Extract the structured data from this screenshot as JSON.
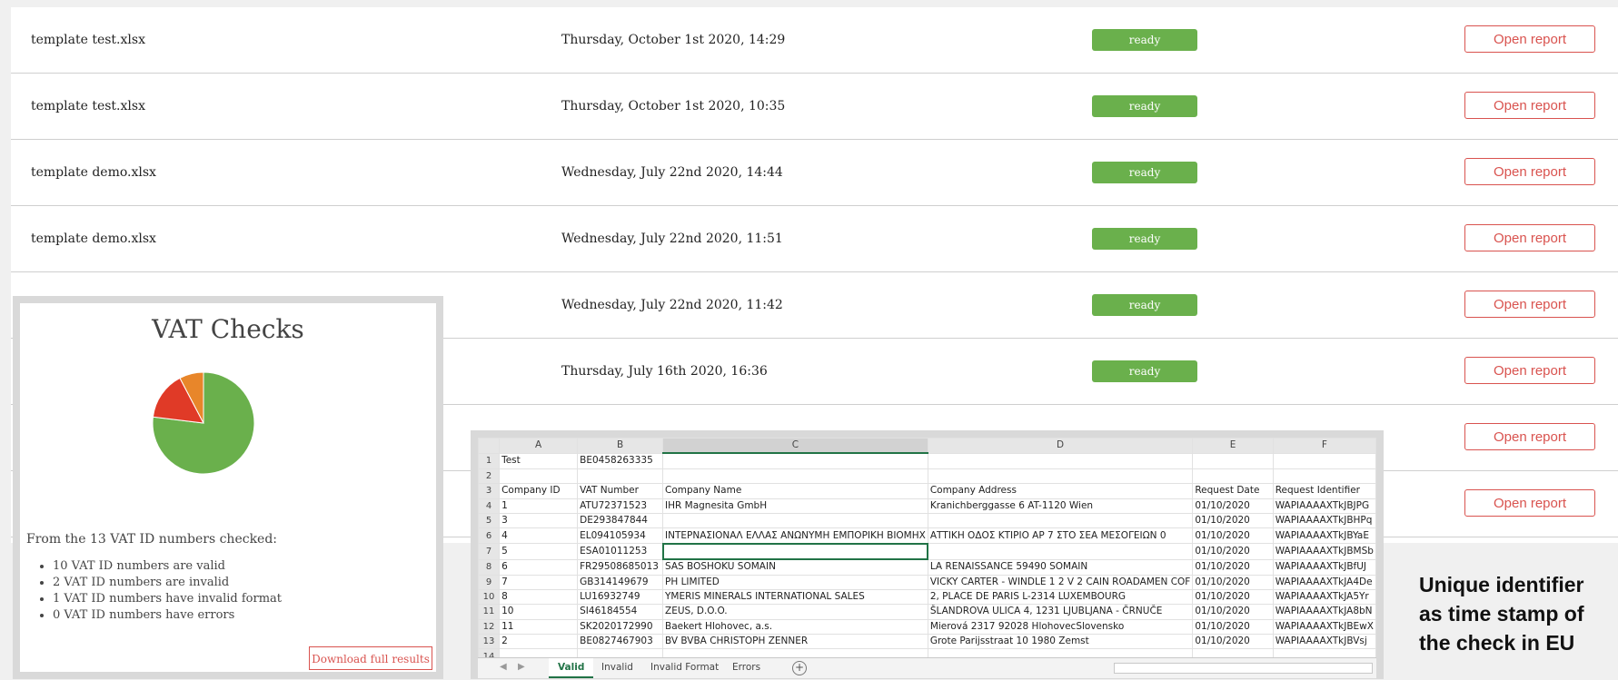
{
  "reports": [
    {
      "name": "template test.xlsx",
      "date": "Thursday, October 1st 2020, 14:29",
      "status": "ready",
      "action": "Open report"
    },
    {
      "name": "template test.xlsx",
      "date": "Thursday, October 1st 2020, 10:35",
      "status": "ready",
      "action": "Open report"
    },
    {
      "name": "template demo.xlsx",
      "date": "Wednesday, July 22nd 2020, 14:44",
      "status": "ready",
      "action": "Open report"
    },
    {
      "name": "template demo.xlsx",
      "date": "Wednesday, July 22nd 2020, 11:51",
      "status": "ready",
      "action": "Open report"
    },
    {
      "name": "",
      "date": "Wednesday, July 22nd 2020, 11:42",
      "status": "ready",
      "action": "Open report"
    },
    {
      "name": "",
      "date": "Thursday, July 16th 2020, 16:36",
      "status": "ready",
      "action": "Open report"
    },
    {
      "name": "",
      "date": "",
      "status": "",
      "action": "Open report"
    },
    {
      "name": "",
      "date": "",
      "status": "",
      "action": "Open report"
    }
  ],
  "vat_panel": {
    "title": "VAT Checks",
    "summary": "From the 13 VAT ID numbers checked:",
    "items": [
      "10 VAT ID numbers are valid",
      "2 VAT ID numbers are invalid",
      "1 VAT ID numbers have invalid format",
      "0 VAT ID numbers have errors"
    ],
    "download": "Download full results"
  },
  "chart_data": {
    "type": "pie",
    "values": [
      10,
      2,
      1,
      0
    ],
    "colors": [
      "#6ab04c",
      "#e03a27",
      "#e8862a",
      "#999999"
    ]
  },
  "spreadsheet": {
    "columns": [
      "A",
      "B",
      "C",
      "D",
      "E",
      "F"
    ],
    "rows": [
      [
        "1",
        "Test",
        "BE0458263335",
        "",
        "",
        "",
        ""
      ],
      [
        "2",
        "",
        "",
        "",
        "",
        "",
        ""
      ],
      [
        "3",
        "Company ID",
        "VAT Number",
        "Company Name",
        "Company Address",
        "Request Date",
        "Request Identifier"
      ],
      [
        "4",
        "1",
        "ATU72371523",
        "IHR Magnesita GmbH",
        "Kranichberggasse 6 AT-1120 Wien",
        "01/10/2020",
        "WAPIAAAAXTkJBJPG"
      ],
      [
        "5",
        "3",
        "DE293847844",
        "",
        "",
        "01/10/2020",
        "WAPIAAAAXTkJBHPq"
      ],
      [
        "6",
        "4",
        "EL094105934",
        "ΙΝΤΕΡΝΑΣΙΟΝΑΛ ΕΛΛΑΣ ΑΝΩΝΥΜΗ ΕΜΠΟΡΙΚΗ ΒΙΟΜΗΧ",
        "ΑΤΤΙΚΗ ΟΔΟΣ ΚΤΙΡΙΟ ΑΡ 7 ΣΤΟ ΣΕΑ ΜΕΣΟΓΕΙΩΝ 0",
        "01/10/2020",
        "WAPIAAAAXTkJBYaE"
      ],
      [
        "7",
        "5",
        "ESA01011253",
        "",
        "",
        "01/10/2020",
        "WAPIAAAAXTkJBMSb"
      ],
      [
        "8",
        "6",
        "FR29508685013",
        "SAS BOSHOKU SOMAIN",
        "LA RENAISSANCE 59490 SOMAIN",
        "01/10/2020",
        "WAPIAAAAXTkJBfUJ"
      ],
      [
        "9",
        "7",
        "GB314149679",
        "PH LIMITED",
        "VICKY CARTER - WINDLE 1 2 V 2 CAIN ROADAMEN COF",
        "01/10/2020",
        "WAPIAAAAXTkJA4De"
      ],
      [
        "10",
        "8",
        "LU16932749",
        "YMERIS MINERALS INTERNATIONAL SALES",
        "2, PLACE DE PARIS L-2314  LUXEMBOURG",
        "01/10/2020",
        "WAPIAAAAXTkJA5Yr"
      ],
      [
        "11",
        "10",
        "SI46184554",
        "ZEUS, D.O.O.",
        "ŠLANDROVA ULICA 4, 1231 LJUBLJANA - ČRNUČE",
        "01/10/2020",
        "WAPIAAAAXTkJA8bN"
      ],
      [
        "12",
        "11",
        "SK2020172990",
        "Baekert Hlohovec, a.s.",
        "Mierová 2317 92028 HlohovecSlovensko",
        "01/10/2020",
        "WAPIAAAAXTkJBEwX"
      ],
      [
        "13",
        "2",
        "BE0827467903",
        "BV BVBA CHRISTOPH ZENNER",
        "Grote Parijsstraat 10 1980 Zemst",
        "01/10/2020",
        "WAPIAAAAXTkJBVsj"
      ],
      [
        "14",
        "",
        "",
        "",
        "",
        "",
        ""
      ]
    ],
    "tabs": [
      "Valid",
      "Invalid",
      "Invalid Format",
      "Errors"
    ],
    "active_tab": "Valid",
    "add_sheet_icon": "plus-circle-icon"
  },
  "caption": "Unique identifier as time stamp of the check in EU"
}
